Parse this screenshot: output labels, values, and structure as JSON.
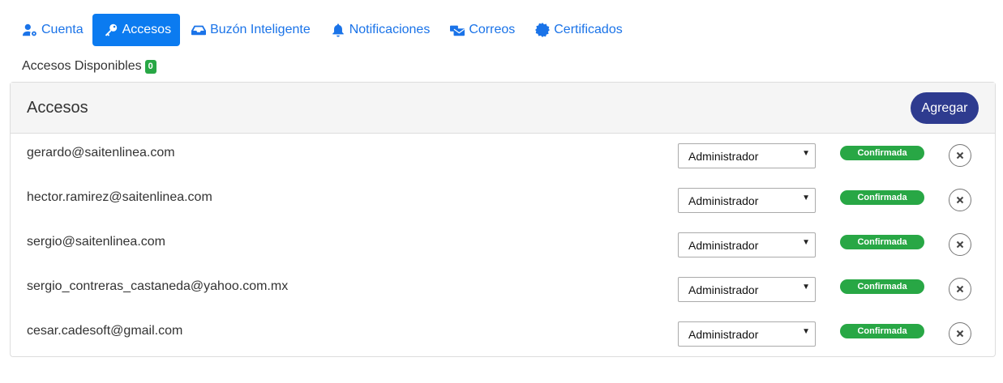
{
  "tabs": [
    {
      "label": "Cuenta",
      "icon": "user-gear-icon",
      "active": false
    },
    {
      "label": "Accesos",
      "icon": "key-icon",
      "active": true
    },
    {
      "label": "Buzón Inteligente",
      "icon": "inbox-icon",
      "active": false
    },
    {
      "label": "Notificaciones",
      "icon": "bell-icon",
      "active": false
    },
    {
      "label": "Correos",
      "icon": "mail-bulk-icon",
      "active": false
    },
    {
      "label": "Certificados",
      "icon": "certificate-icon",
      "active": false
    }
  ],
  "available": {
    "label": "Accesos Disponibles",
    "count": "0"
  },
  "panel": {
    "title": "Accesos",
    "add_label": "Agregar"
  },
  "users": [
    {
      "email": "gerardo@saitenlinea.com",
      "role": "Administrador",
      "status": "Confirmada"
    },
    {
      "email": "hector.ramirez@saitenlinea.com",
      "role": "Administrador",
      "status": "Confirmada"
    },
    {
      "email": "sergio@saitenlinea.com",
      "role": "Administrador",
      "status": "Confirmada"
    },
    {
      "email": "sergio_contreras_castaneda@yahoo.com.mx",
      "role": "Administrador",
      "status": "Confirmada"
    },
    {
      "email": "cesar.cadesoft@gmail.com",
      "role": "Administrador",
      "status": "Confirmada"
    }
  ],
  "colors": {
    "accent": "#0b7bf0",
    "link": "#1a73e8",
    "success": "#28a745",
    "primary_button": "#2e3b8f"
  }
}
